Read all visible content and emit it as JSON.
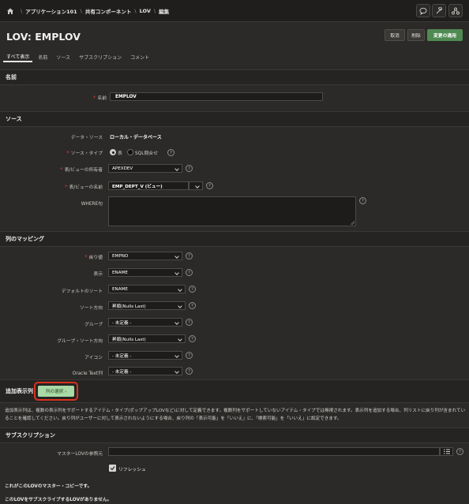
{
  "breadcrumb": {
    "items": [
      "アプリケーション101",
      "共有コンポーネント",
      "LOV",
      "編集"
    ]
  },
  "toolbar": {
    "icons": [
      "chat-icon",
      "wrench-icon",
      "share-icon"
    ]
  },
  "page": {
    "title": "LOV: EMPLOV",
    "cancel_label": "取消",
    "delete_label": "削除",
    "apply_label": "変更の適用"
  },
  "tabs": [
    {
      "label": "すべて表示",
      "active": true
    },
    {
      "label": "名前"
    },
    {
      "label": "ソース"
    },
    {
      "label": "サブスクリプション"
    },
    {
      "label": "コメント"
    }
  ],
  "sections": {
    "name": "名前",
    "source": "ソース",
    "mapping": "列のマッピング",
    "additional": "追加表示列",
    "subscription": "サブスクリプション"
  },
  "name_field": {
    "label": "名前",
    "value": "EMPLOV"
  },
  "source": {
    "data_source_label": "データ・ソース",
    "data_source_value": "ローカル・データベース",
    "source_type_label": "ソース・タイプ",
    "radio_table": "表",
    "radio_sql": "SQL問合せ",
    "owner_label": "表/ビューの所有者",
    "owner_value": "APEXDEV",
    "table_label": "表/ビューの名前",
    "table_value": "EMP_DEPT_V (ビュー)",
    "where_label": "WHERE句"
  },
  "mapping": {
    "return_label": "戻り値",
    "return_value": "EMPNO",
    "display_label": "表示",
    "display_value": "ENAME",
    "default_sort_label": "デフォルトのソート",
    "default_sort_value": "ENAME",
    "sort_dir_label": "ソート方向",
    "sort_dir_value": "昇順(Nulls Last)",
    "group_label": "グループ",
    "group_value": "- 未定義 -",
    "group_sort_label": "グループ・ソート方向",
    "group_sort_value": "昇順(Nulls Last)",
    "icon_label": "アイコン",
    "icon_value": "- 未定義 -",
    "oracle_text_label": "Oracle Text列",
    "oracle_text_value": "- 未定義 -"
  },
  "additional": {
    "pick_button": "列の選択 ›",
    "description": "追加表示列は、複数の表示列をサポートするアイテム・タイプ(ポップアップLOVなど)に対して定義できます。複数列をサポートしていないアイテム・タイプでは無視されます。表示列を追加する場合、列リストに戻り列が含まれていることを確認してください。戻り列がユーザーに対して表示されないようにする場合、戻り列の「表示可能」を「いいえ」に、「検索可能」を「いいえ」に設定できます。"
  },
  "subscription": {
    "master_label": "マスターLOVの参照元",
    "refresh_label": "リフレッシュ",
    "master_copy_text": "これがこのLOVのマスター・コピーです。",
    "no_subscribers_text": "このLOVをサブスクライブするLOVがありません。"
  },
  "colors": {
    "background": "#2b2a28",
    "accent_green": "#4f8a52",
    "highlight_red": "#d9321f",
    "required_red": "#d23c3c"
  }
}
